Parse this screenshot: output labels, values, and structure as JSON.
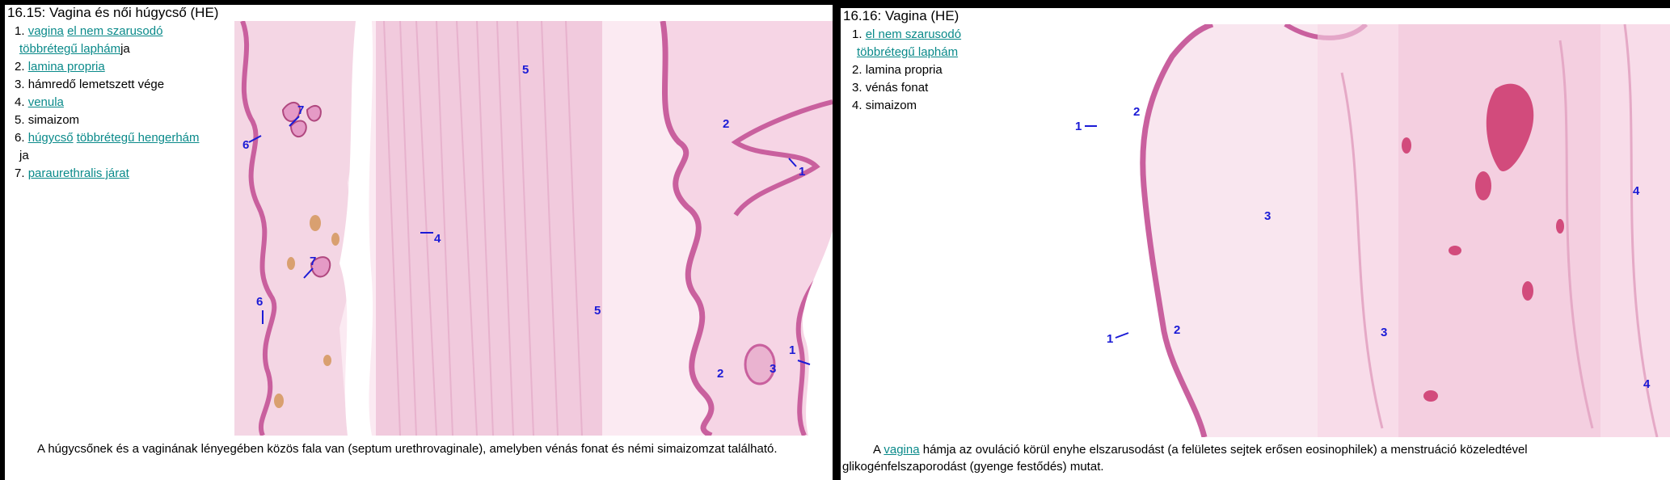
{
  "panel1": {
    "title": "16.15: Vagina és női húgycső (HE)",
    "legend": [
      {
        "num": "1.",
        "segments": [
          {
            "text": "vagina",
            "link": true
          },
          {
            "text": " ",
            "link": false
          },
          {
            "text": "el nem szarusodó",
            "link": true
          }
        ],
        "line2": [
          {
            "text": "többrétegű laphám",
            "link": true
          },
          {
            "text": "ja",
            "link": false
          }
        ]
      },
      {
        "num": "2.",
        "segments": [
          {
            "text": "lamina propria",
            "link": true
          }
        ]
      },
      {
        "num": "3.",
        "segments": [
          {
            "text": "hámredő lemetszett vége",
            "link": false
          }
        ]
      },
      {
        "num": "4.",
        "segments": [
          {
            "text": "venula",
            "link": true
          }
        ]
      },
      {
        "num": "5.",
        "segments": [
          {
            "text": "simaizom",
            "link": false
          }
        ]
      },
      {
        "num": "6.",
        "segments": [
          {
            "text": "húgycső",
            "link": true
          },
          {
            "text": " ",
            "link": false
          },
          {
            "text": "többrétegű hengerhám",
            "link": true
          }
        ],
        "line2": [
          {
            "text": "ja",
            "link": false
          }
        ]
      },
      {
        "num": "7.",
        "segments": [
          {
            "text": "paraurethralis járat",
            "link": true
          }
        ]
      }
    ],
    "caption": "A húgycsőnek és a vaginának lényegében közös fala van (septum urethrovaginale), amelyben vénás fonat és némi simaizomzat található.",
    "image_labels": [
      "1",
      "1",
      "2",
      "2",
      "3",
      "4",
      "5",
      "5",
      "6",
      "6",
      "7",
      "7"
    ]
  },
  "panel2": {
    "title": "16.16: Vagina (HE)",
    "legend": [
      {
        "num": "1.",
        "segments": [
          {
            "text": "el nem szarusodó",
            "link": true
          }
        ],
        "line2": [
          {
            "text": "többrétegű laphám",
            "link": true
          }
        ]
      },
      {
        "num": "2.",
        "segments": [
          {
            "text": "lamina propria",
            "link": false
          }
        ]
      },
      {
        "num": "3.",
        "segments": [
          {
            "text": "vénás fonat",
            "link": false
          }
        ]
      },
      {
        "num": "4.",
        "segments": [
          {
            "text": "simaizom",
            "link": false
          }
        ]
      }
    ],
    "caption": {
      "before": "A ",
      "link": "vagina",
      "after": " hámja az ovuláció körül enyhe elszarusodást (a felületes sejtek erősen eosinophilek) a menstruáció közeledtével",
      "line2": "glikogénfelszaporodást (gyenge festődés) mutat."
    },
    "image_labels": [
      "1",
      "1",
      "2",
      "2",
      "3",
      "3",
      "4",
      "4"
    ]
  },
  "colors": {
    "background": "#000000",
    "link": "#0a8a8a",
    "label": "#1b1bd6",
    "tissue_light": "#f7dbe9",
    "tissue_mid": "#ecb5d2",
    "epithelium": "#c9609e",
    "vessel": "#c2183e",
    "venule": "#c98a5a"
  }
}
